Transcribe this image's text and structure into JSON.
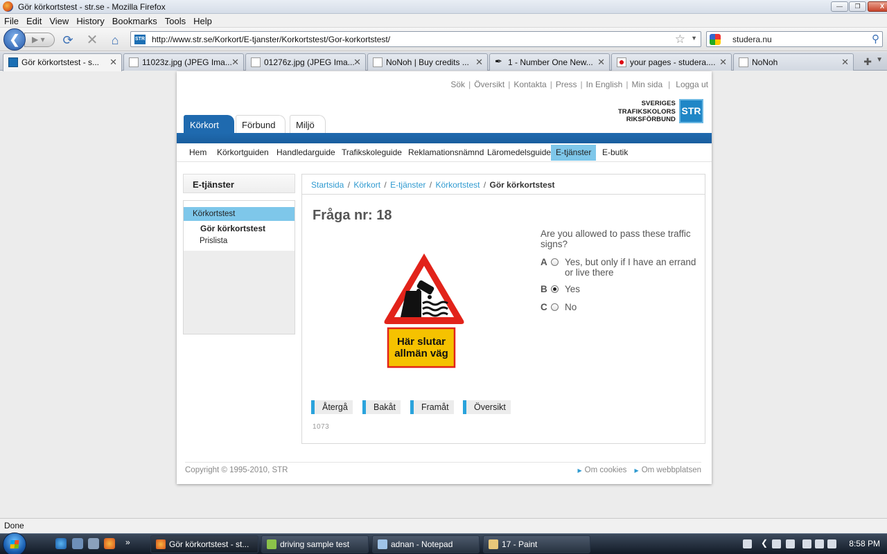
{
  "window": {
    "title": "Gör körkortstest - str.se - Mozilla Firefox"
  },
  "menu": [
    "File",
    "Edit",
    "View",
    "History",
    "Bookmarks",
    "Tools",
    "Help"
  ],
  "address": {
    "url": "http://www.str.se/Korkort/E-tjanster/Korkortstest/Gor-korkortstest/",
    "search_text": "studera.nu"
  },
  "tabs": [
    {
      "label": "Gör körkortstest - s...",
      "icon": "str-favicon"
    },
    {
      "label": "11023z.jpg (JPEG Ima...",
      "icon": "image-icon"
    },
    {
      "label": "01276z.jpg (JPEG Ima...",
      "icon": "image-icon"
    },
    {
      "label": "NoNoh | Buy credits ...",
      "icon": "page-icon"
    },
    {
      "label": "1 - Number One New...",
      "icon": "feather-icon"
    },
    {
      "label": "your pages - studera....",
      "icon": "flag-icon"
    },
    {
      "label": "NoNoh",
      "icon": "page-icon"
    }
  ],
  "site": {
    "top_links": [
      "Sök",
      "Översikt",
      "Kontakta",
      "Press",
      "In English",
      "Min sida",
      "Logga ut"
    ],
    "brand": {
      "line1": "SVERIGES",
      "line2": "TRAFIKSKOLORS",
      "line3": "RIKSFÖRBUND",
      "mark": "STR"
    },
    "main_tabs": [
      "Körkort",
      "Förbund",
      "Miljö"
    ],
    "sub_nav": [
      "Hem",
      "Körkortguiden",
      "Handledarguide",
      "Trafikskoleguide",
      "Reklamationsnämnd",
      "Läromedelsguide",
      "E-tjänster",
      "E-butik"
    ],
    "sidebar": {
      "heading": "E-tjänster",
      "items": [
        "Körkortstest",
        "Gör körkortstest",
        "Prislista"
      ]
    },
    "breadcrumb": [
      "Startsida",
      "Körkort",
      "E-tjänster",
      "Körkortstest",
      "Gör körkortstest"
    ],
    "question": {
      "title": "Fråga nr: 18",
      "text": "Are you allowed to pass these traffic signs?",
      "sign_text_line1": "Här slutar",
      "sign_text_line2": "allmän väg",
      "options": [
        {
          "letter": "A",
          "label": "Yes, but only if I have an errand or live there",
          "selected": false
        },
        {
          "letter": "B",
          "label": "Yes",
          "selected": true
        },
        {
          "letter": "C",
          "label": "No",
          "selected": false
        }
      ],
      "buttons": [
        "Återgå",
        "Bakåt",
        "Framåt",
        "Översikt"
      ],
      "id": "1073"
    },
    "footer": {
      "copyright": "Copyright © 1995-2010, STR",
      "links": [
        "Om cookies",
        "Om webbplatsen"
      ]
    },
    "colors": {
      "brand_blue": "#1f6aaf",
      "highlight": "#7ec7ea",
      "link": "#2f9ad0"
    }
  },
  "status": "Done",
  "taskbar": {
    "tasks": [
      "Gör körkortstest - st...",
      "driving sample test",
      "adnan - Notepad",
      "17 - Paint"
    ],
    "clock": "8:58 PM"
  }
}
